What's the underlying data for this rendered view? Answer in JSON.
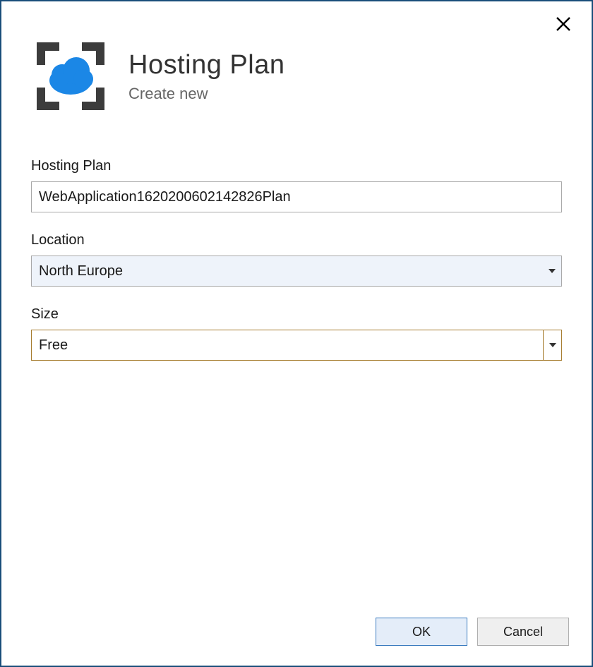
{
  "header": {
    "title": "Hosting Plan",
    "subtitle": "Create new"
  },
  "form": {
    "hosting_plan_label": "Hosting Plan",
    "hosting_plan_value": "WebApplication1620200602142826Plan",
    "location_label": "Location",
    "location_value": "North Europe",
    "size_label": "Size",
    "size_value": "Free"
  },
  "buttons": {
    "ok_label": "OK",
    "cancel_label": "Cancel"
  }
}
